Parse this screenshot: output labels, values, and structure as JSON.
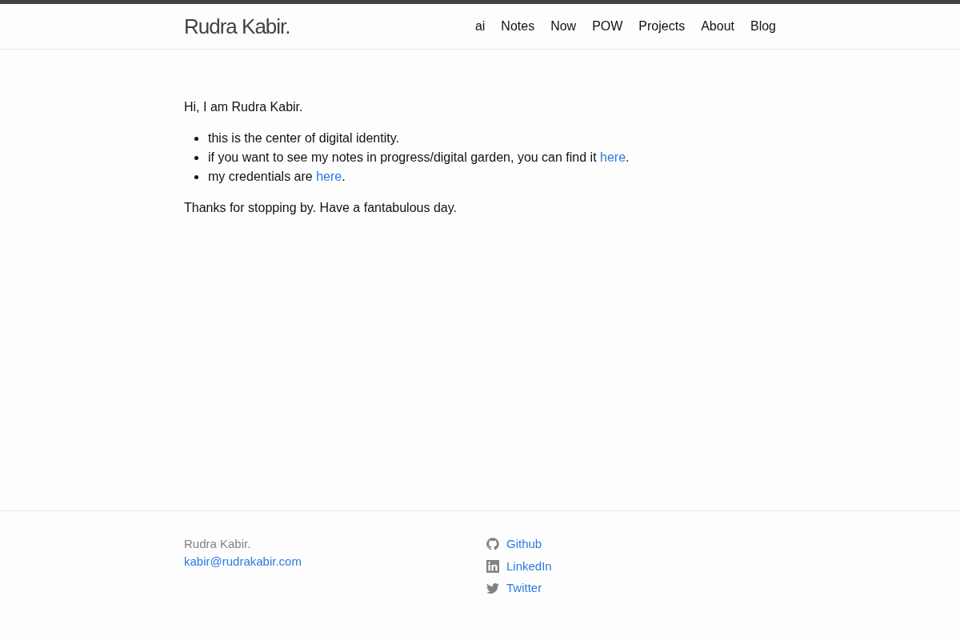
{
  "header": {
    "site_title": "Rudra Kabir.",
    "nav": [
      {
        "label": "ai"
      },
      {
        "label": "Notes"
      },
      {
        "label": "Now"
      },
      {
        "label": "POW"
      },
      {
        "label": "Projects"
      },
      {
        "label": "About"
      },
      {
        "label": "Blog"
      }
    ]
  },
  "content": {
    "intro": "Hi, I am Rudra Kabir.",
    "bullets": [
      {
        "text": "this is the center of digital identity."
      },
      {
        "text": "if you want to see my notes in progress/digital garden, you can find it ",
        "link": "here",
        "after": "."
      },
      {
        "text": "my credentials are ",
        "link": "here",
        "after": "."
      }
    ],
    "closing": "Thanks for stopping by. Have a fantabulous day."
  },
  "footer": {
    "name": "Rudra Kabir.",
    "email": "kabir@rudrakabir.com",
    "social": [
      {
        "kind": "github",
        "label": "Github"
      },
      {
        "kind": "linkedin",
        "label": "LinkedIn"
      },
      {
        "kind": "twitter",
        "label": "Twitter"
      }
    ]
  }
}
